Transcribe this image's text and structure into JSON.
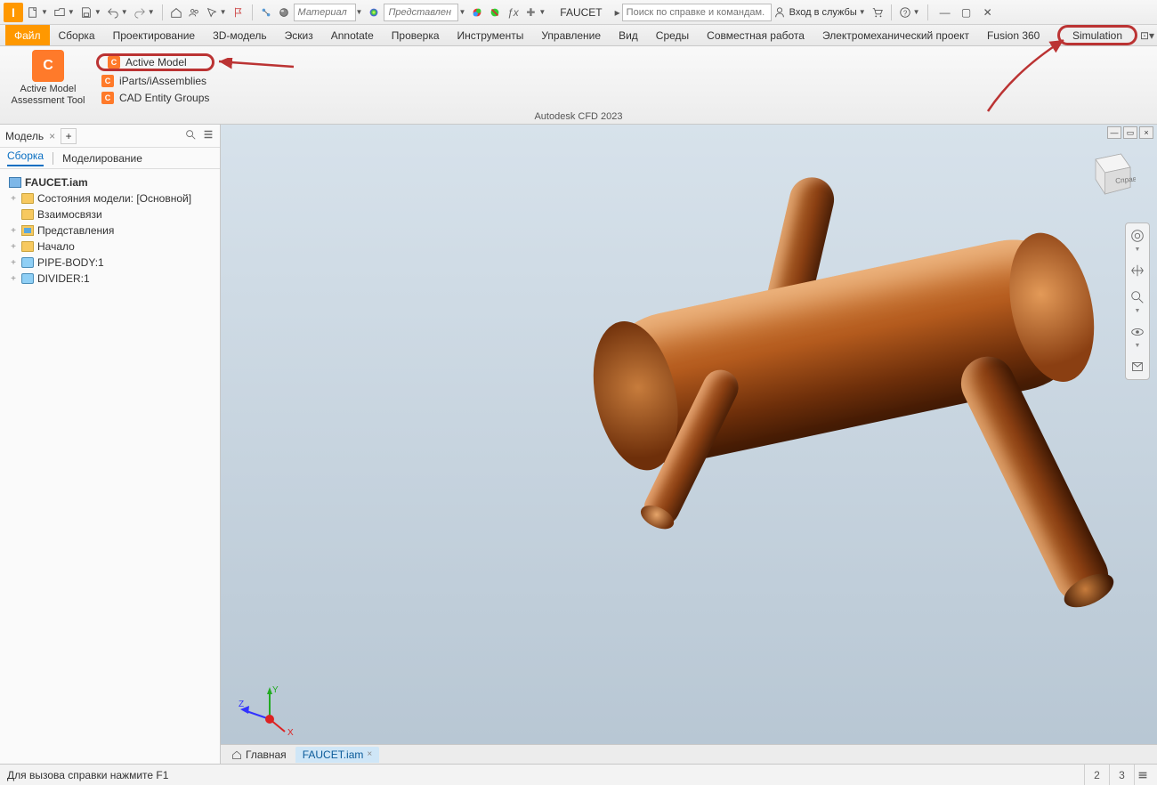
{
  "qat": {
    "material_placeholder": "Материал",
    "appearance_placeholder": "Представлен",
    "doc_label": "FAUCET",
    "search_placeholder": "Поиск по справке и командам.",
    "signin": "Вход в службы"
  },
  "ribbon_tabs": [
    "Файл",
    "Сборка",
    "Проектирование",
    "3D-модель",
    "Эскиз",
    "Annotate",
    "Проверка",
    "Инструменты",
    "Управление",
    "Вид",
    "Среды",
    "Совместная работа",
    "Электромеханический проект",
    "Fusion 360",
    "Simulation"
  ],
  "ribbon_panel": {
    "big_button_line1": "Active Model",
    "big_button_line2": "Assessment Tool",
    "items": [
      "Active Model",
      "iParts/iAssemblies",
      "CAD Entity Groups"
    ],
    "footer": "Autodesk CFD 2023"
  },
  "browser": {
    "title": "Модель",
    "tabs": [
      "Сборка",
      "Моделирование"
    ],
    "root": "FAUCET.iam",
    "nodes": [
      {
        "label": "Состояния модели: [Основной]",
        "type": "folder",
        "expander": "+"
      },
      {
        "label": "Взаимосвязи",
        "type": "folder",
        "expander": ""
      },
      {
        "label": "Представления",
        "type": "folder-rep",
        "expander": "+"
      },
      {
        "label": "Начало",
        "type": "folder",
        "expander": "+"
      },
      {
        "label": "PIPE-BODY:1",
        "type": "part",
        "expander": "+"
      },
      {
        "label": "DIVIDER:1",
        "type": "part",
        "expander": "+"
      }
    ]
  },
  "viewcube": {
    "face": "Справа"
  },
  "doctabs": {
    "home": "Главная",
    "active": "FAUCET.iam"
  },
  "status": {
    "hint": "Для вызова справки нажмите F1",
    "num1": "2",
    "num2": "3"
  },
  "triad": {
    "x": "X",
    "y": "Y",
    "z": "Z"
  }
}
